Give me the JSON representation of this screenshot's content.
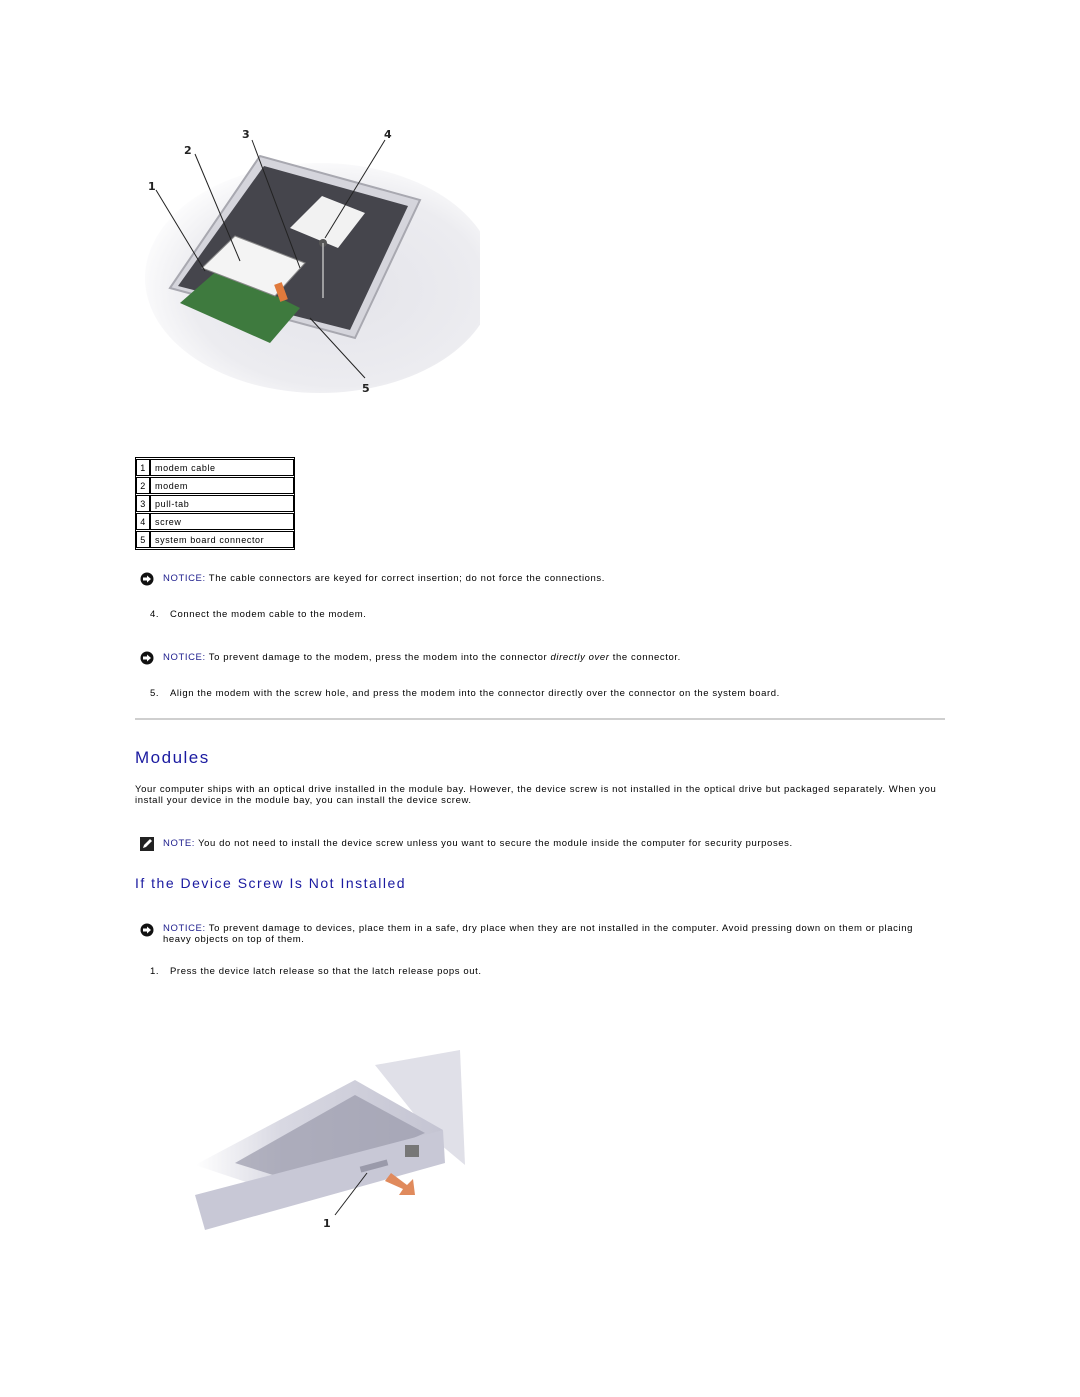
{
  "figure1": {
    "alt": "Modem installation in laptop bottom compartment",
    "callouts": [
      "1",
      "2",
      "3",
      "4",
      "5"
    ]
  },
  "legend": [
    {
      "num": "1",
      "label": "modem cable"
    },
    {
      "num": "2",
      "label": "modem"
    },
    {
      "num": "3",
      "label": "pull-tab"
    },
    {
      "num": "4",
      "label": "screw"
    },
    {
      "num": "5",
      "label": "system board connector"
    }
  ],
  "notices": {
    "n1": {
      "label": "NOTICE:",
      "text": " The cable connectors are keyed for correct insertion; do not force the connections."
    },
    "n2": {
      "label": "NOTICE:",
      "text_before": " To prevent damage to the modem, press the modem into the connector ",
      "emphasis": "directly over",
      "text_after": " the connector."
    },
    "n3": {
      "label": "NOTICE:",
      "text": " To prevent damage to devices, place them in a safe, dry place when they are not installed in the computer. Avoid pressing down on them or placing heavy objects on top of them."
    }
  },
  "note": {
    "label": "NOTE:",
    "text": " You do not need to install the device screw unless you want to secure the module inside the computer for security purposes."
  },
  "steps": {
    "s4": {
      "num": "4.",
      "text": "Connect the modem cable to the modem."
    },
    "s5": {
      "num": "5.",
      "text": "Align the modem with the screw hole, and press the modem into the connector directly over the connector on the system board."
    },
    "s1": {
      "num": "1.",
      "text": "Press the device latch release so that the latch release pops out."
    }
  },
  "modules": {
    "heading": "Modules",
    "paragraph": " Your computer ships with an optical drive installed in the module bay. However, the device screw is not installed in the optical drive but packaged separately. When you install your device in the module bay, you can install the device screw."
  },
  "subheading": "If the Device Screw Is Not Installed",
  "figure2": {
    "alt": "Laptop side view with device latch release",
    "callouts": [
      "1"
    ]
  },
  "colors": {
    "heading": "#1a1aa0",
    "label": "#1c1c8c",
    "rule": "#cfcfcf"
  }
}
